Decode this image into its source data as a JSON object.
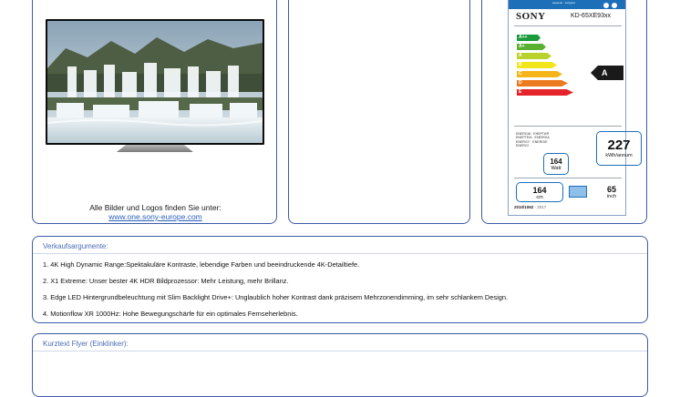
{
  "images_panel": {
    "caption": "Alle Bilder und Logos finden Sie unter:",
    "link": "www.one.sony-europe.com"
  },
  "energy_label": {
    "eu_text": "енергия · ενέργεια",
    "brand": "SONY",
    "model": "KD-65XE93xx",
    "scale": [
      {
        "label": "A++",
        "color": "#1a9a3a"
      },
      {
        "label": "A+",
        "color": "#5ab030"
      },
      {
        "label": "A",
        "color": "#b9d22e"
      },
      {
        "label": "B",
        "color": "#f2e51a"
      },
      {
        "label": "C",
        "color": "#f5b519"
      },
      {
        "label": "D",
        "color": "#ec7a1e"
      },
      {
        "label": "E",
        "color": "#e3242b"
      }
    ],
    "rating": "A",
    "legal_lines": [
      "ENERGIA · ЕНЕРГИЯ",
      "ΕΝΕΡΓΕΙΑ · ENERGIA",
      "ENERGY · ENERGIE",
      "ENERGI"
    ],
    "kwh_value": "227",
    "kwh_unit": "kWh/annum",
    "watt_value": "164",
    "watt_unit": "Watt",
    "cm_value": "164",
    "cm_unit": "cm",
    "inch_value": "65",
    "inch_unit": "inch",
    "regulation": "2010/1062",
    "regulation_year": " - 2017"
  },
  "usp_section": {
    "title": "Verkaufsargumente:",
    "items": [
      "1. 4K High Dynamic Range:Spektakuläre Kontraste, lebendige Farben und beeindruckende 4K-Detailtiefe.",
      "2. X1 Extreme: Unser bester 4K HDR Bildprozessor: Mehr Leistung, mehr Brillanz.",
      "3. Edge LED Hintergrundbeleuchtung mit Slim Backlight Drive+: Unglaublich hoher Kontrast dank präzisem Mehrzonendimming, im sehr schlankem Design.",
      "4. Motionflow XR 1000Hz: Hohe Bewegungschärfe für ein optimales Fernseherlebnis."
    ]
  },
  "flyer_section": {
    "title": "Kurztext Flyer (Einklinker):"
  }
}
